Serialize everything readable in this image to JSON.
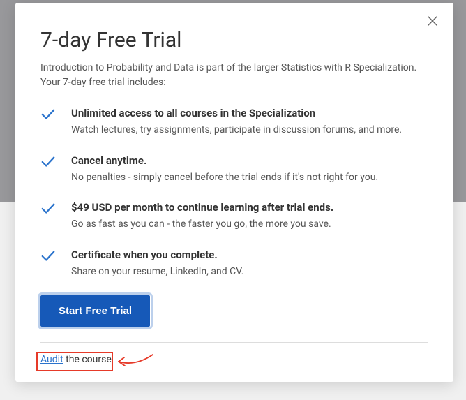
{
  "modal": {
    "title": "7-day Free Trial",
    "subtitle": "Introduction to Probability and Data is part of the larger Statistics with R Specialization. Your 7-day free trial includes:",
    "features": [
      {
        "title": "Unlimited access to all courses in the Specialization",
        "desc": "Watch lectures, try assignments, participate in discussion forums, and more."
      },
      {
        "title": "Cancel anytime.",
        "desc": "No penalties - simply cancel before the trial ends if it's not right for you."
      },
      {
        "title": "$49 USD per month to continue learning after trial ends.",
        "desc": "Go as fast as you can - the faster you go, the more you save."
      },
      {
        "title": "Certificate when you complete.",
        "desc": "Share on your resume, LinkedIn, and CV."
      }
    ],
    "startButton": "Start Free Trial",
    "auditLink": "Audit",
    "auditRest": " the course"
  }
}
